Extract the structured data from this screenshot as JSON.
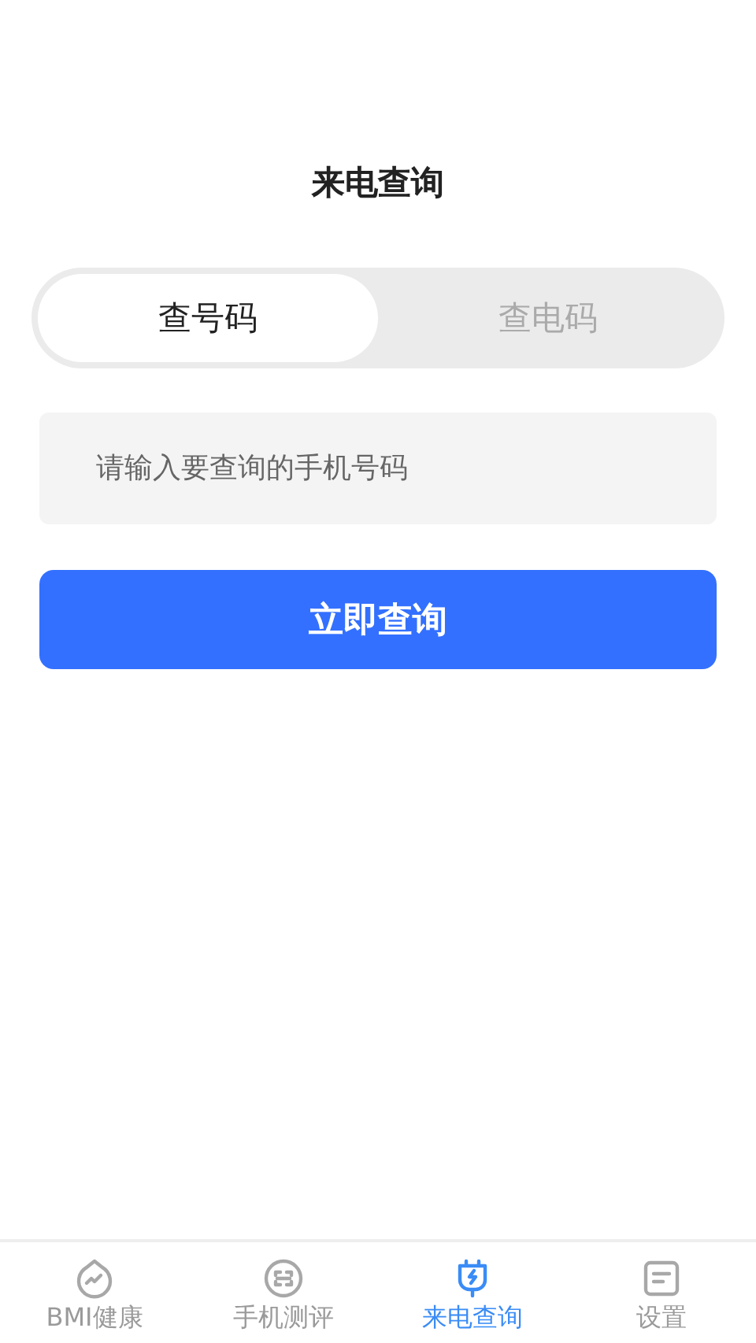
{
  "title": "来电查询",
  "tabs": [
    {
      "label": "查号码",
      "selected": true
    },
    {
      "label": "查电码",
      "selected": false
    }
  ],
  "search": {
    "placeholder": "请输入要查询的手机号码"
  },
  "submit": "立即查询",
  "nav": [
    {
      "label": "BMI健康",
      "kind": "chart",
      "selected": false
    },
    {
      "label": "手机测评",
      "kind": "scan",
      "selected": false
    },
    {
      "label": "来电查询",
      "kind": "plug",
      "selected": true
    },
    {
      "label": "设置",
      "kind": "doc",
      "selected": false
    }
  ]
}
